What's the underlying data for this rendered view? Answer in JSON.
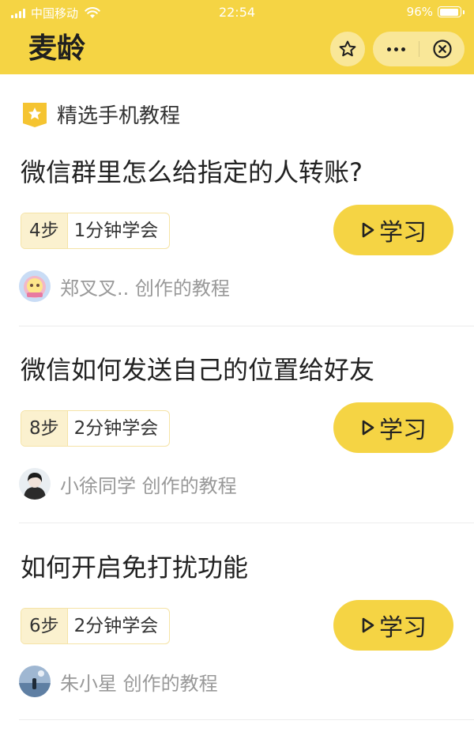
{
  "status_bar": {
    "carrier": "中国移动",
    "time": "22:54",
    "battery": "96%",
    "battery_level": 0.96
  },
  "header": {
    "title": "麦龄",
    "icons": [
      "star-icon",
      "more-icon",
      "close-icon"
    ]
  },
  "section": {
    "title": "精选手机教程",
    "icon": "star-badge-icon"
  },
  "colors": {
    "brand": "#f5d444",
    "meta_steps_bg": "#fbf1cf",
    "meta_border": "#f5e3a6",
    "author_text": "#999999"
  },
  "tutorials": [
    {
      "title": "微信群里怎么给指定的人转账?",
      "steps": "4步",
      "duration": "1分钟学会",
      "button": "学习",
      "author": "郑叉叉.. 创作的教程"
    },
    {
      "title": "微信如何发送自己的位置给好友",
      "steps": "8步",
      "duration": "2分钟学会",
      "button": "学习",
      "author": "小徐同学 创作的教程"
    },
    {
      "title": "如何开启免打扰功能",
      "steps": "6步",
      "duration": "2分钟学会",
      "button": "学习",
      "author": "朱小星 创作的教程"
    }
  ]
}
